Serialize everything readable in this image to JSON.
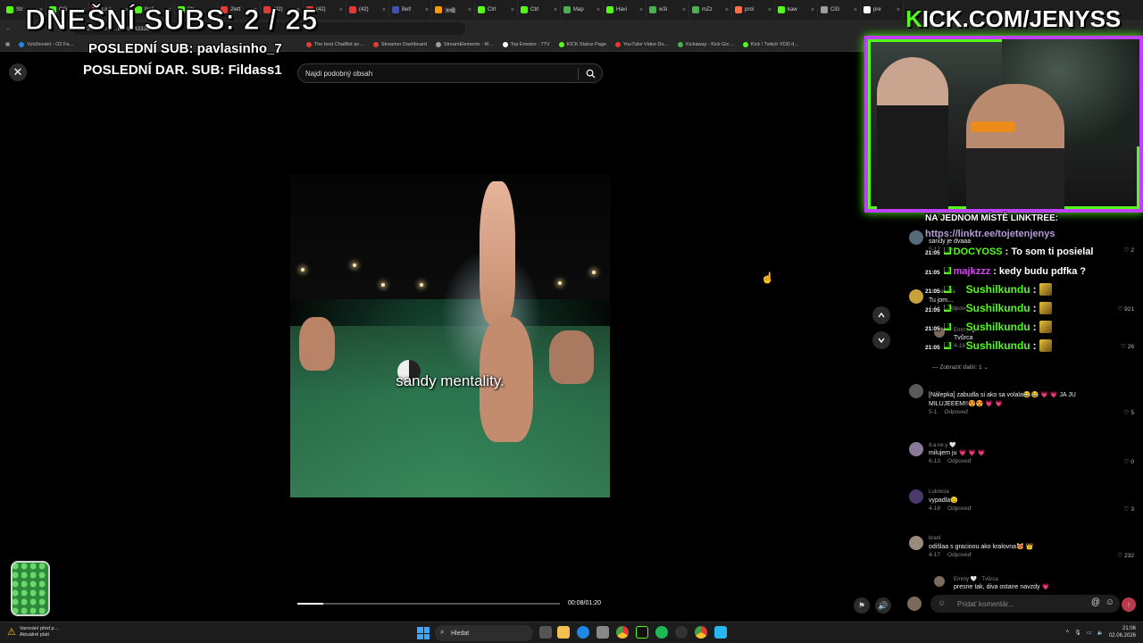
{
  "browser": {
    "tabs": [
      {
        "label": "Str",
        "color": "#53fc18"
      },
      {
        "label": "OG",
        "color": "#53fc18"
      },
      {
        "label": "Live",
        "color": "#e53935"
      },
      {
        "label": "Neli",
        "color": "#53fc18"
      },
      {
        "label": "Str",
        "color": "#53fc18"
      },
      {
        "label": "2lett",
        "color": "#e53935"
      },
      {
        "label": "(42)",
        "color": "#e53935"
      },
      {
        "label": "(42)",
        "color": "#e53935"
      },
      {
        "label": "(42)",
        "color": "#e53935"
      },
      {
        "label": "Bet!",
        "color": "#3f51b5"
      },
      {
        "label": "沖縄",
        "color": "#ff9800"
      },
      {
        "label": "Ctrl",
        "color": "#53fc18"
      },
      {
        "label": "Ctrl",
        "color": "#53fc18"
      },
      {
        "label": "Map",
        "color": "#4caf50"
      },
      {
        "label": "Havi",
        "color": "#53fc18"
      },
      {
        "label": "w3i",
        "color": "#4caf50"
      },
      {
        "label": "mZz",
        "color": "#4caf50"
      },
      {
        "label": "prol",
        "color": "#ff7043"
      },
      {
        "label": "kaw",
        "color": "#53fc18"
      },
      {
        "label": "ClG",
        "color": "#9e9e9e"
      },
      {
        "label": "pre",
        "color": "#ffffff"
      }
    ],
    "url": "…2%2&0ne…85697433384",
    "bookmarks": [
      {
        "label": "Vyúčtování - O2 Fa…",
        "color": "#1e88e5"
      },
      {
        "label": "The best ChatBot an…",
        "color": "#e53935"
      },
      {
        "label": "Streamer Dashboard",
        "color": "#e53935"
      },
      {
        "label": "StreamElements - M…",
        "color": "#9e9e9e"
      },
      {
        "label": "Top Emotes - 7TV",
        "color": "#ffffff"
      },
      {
        "label": "KICK Status Page",
        "color": "#53fc18"
      },
      {
        "label": "YouTube Video Do…",
        "color": "#e53935"
      },
      {
        "label": "Kickaway - Kick Giv…",
        "color": "#4caf50"
      },
      {
        "label": "Kick / Twitch VOD d…",
        "color": "#53fc18"
      }
    ]
  },
  "search": {
    "placeholder": "Najdi podobný obsah"
  },
  "video": {
    "caption": "sandy mentality.",
    "current_time": "00:08",
    "duration": "01:20",
    "time_label": "00:08/01:20",
    "progress": 0.1
  },
  "comments": {
    "items": [
      {
        "user": "",
        "text": "sandy je dvaaa",
        "meta": "5-12",
        "reply": "Odpoveď",
        "likes": "2",
        "avatar": "#556b7a"
      },
      {
        "user": "shopadeda",
        "text": "Tu jom…",
        "meta": "4-16",
        "reply": "Odpoveď",
        "likes": "921",
        "avatar": "#c7a23a"
      },
      {
        "user": "Emmy 🤍 · Tvůrca",
        "text": "Tvůrca",
        "meta": "4-16",
        "reply": "Odpoveď",
        "likes": "26",
        "avatar": "#7a6b5c"
      },
      {
        "user": "·",
        "text": "[Nálepka] zabudla si ako sa volala😂😂 💗 💗 JA JU MILUJEEEM!!😍😍 💗 💗",
        "meta": "5-1",
        "reply": "Odpoveď",
        "likes": "5",
        "avatar": "#5a5a5a"
      },
      {
        "user": "d.a.ne.y 🤍",
        "text": "milujem ju 💗 💗 💗",
        "meta": "6-13",
        "reply": "Odpoveď",
        "likes": "0",
        "avatar": "#8a7a9a"
      },
      {
        "user": "Lukrecia",
        "text": "vypadla😟",
        "meta": "4-18",
        "reply": "Odpoveď",
        "likes": "3",
        "avatar": "#4a3a6a"
      },
      {
        "user": "branl",
        "text": "odišlaa s gracioou ako kralovna😻 👑",
        "meta": "4-17",
        "reply": "Odpoveď",
        "likes": "232",
        "avatar": "#9a8a7a"
      },
      {
        "user": "Emmy 🤍 · Tvůrca",
        "text": "presne tak, diva ostane navzdy 💗",
        "meta": "",
        "reply": "",
        "likes": "",
        "avatar": "#7a6b5c"
      }
    ],
    "more_replies": "Zobraziť ďalší: 1",
    "input_placeholder": "Pridať komentár..."
  },
  "overlay": {
    "subs_goal": "DNEŠNÍ SUBS: 2 / 25",
    "last_sub": "POSLEDNÍ SUB: pavlasinho_7",
    "last_gift_sub": "POSLEDNÍ DAR. SUB: Fildass1",
    "kick_url_prefix": "K",
    "kick_url_rest": "ICK.COM/JENYSS",
    "chat": [
      {
        "time": "",
        "user": "NA JEDNOM MÍSTĚ LINKTREE:",
        "message": "",
        "color": "#ffffff"
      },
      {
        "time": "",
        "user": "https://linktr.ee/tojetenjenys",
        "message": "",
        "color": "#b39ddb"
      },
      {
        "time": "21:05",
        "user": "DOCYOSS",
        "message": ": To som ti posielal",
        "color": "#53fc18"
      },
      {
        "time": "21:05",
        "user": "majkzzz",
        "message": ": kedy budu pdfka ?",
        "color": "#e040fb"
      },
      {
        "time": "21:05",
        "user": "Sushilkundu",
        "message": ":",
        "color": "#53fc18"
      },
      {
        "time": "21:05",
        "user": "Sushilkundu",
        "message": ":",
        "color": "#53fc18"
      },
      {
        "time": "21:05",
        "user": "Sushilkundu",
        "message": ":",
        "color": "#53fc18"
      },
      {
        "time": "21:05",
        "user": "Sushilkundu",
        "message": ":",
        "color": "#53fc18"
      }
    ]
  },
  "taskbar": {
    "warning_line1": "Varování před p…",
    "warning_line2": "Aktuálně platí",
    "search_label": "Hledat",
    "time": "21:06",
    "date": "02.06.2026"
  },
  "colors": {
    "kick_green": "#53fc18",
    "frame_purple": "#c040ff"
  }
}
